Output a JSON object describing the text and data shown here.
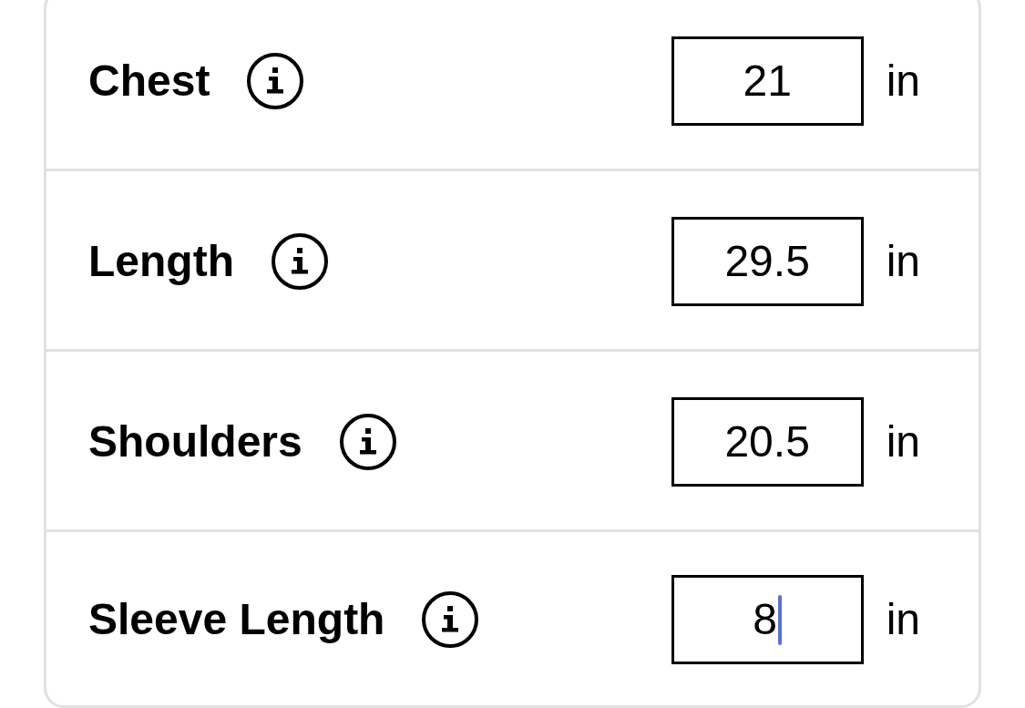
{
  "rows": [
    {
      "label": "Chest",
      "value": "21",
      "unit": "in",
      "focused": false
    },
    {
      "label": "Length",
      "value": "29.5",
      "unit": "in",
      "focused": false
    },
    {
      "label": "Shoulders",
      "value": "20.5",
      "unit": "in",
      "focused": false
    },
    {
      "label": "Sleeve Length",
      "value": "8",
      "unit": "in",
      "focused": true
    }
  ]
}
